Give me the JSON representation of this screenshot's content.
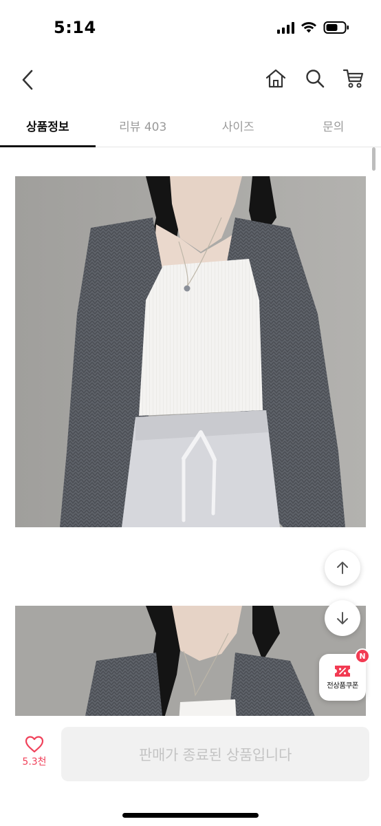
{
  "status_bar": {
    "time": "5:14"
  },
  "header": {
    "icons": [
      "back-icon",
      "home-icon",
      "search-icon",
      "cart-icon"
    ]
  },
  "tabs": [
    {
      "label": "상품정보",
      "active": true
    },
    {
      "label": "리뷰 403",
      "active": false
    },
    {
      "label": "사이즈",
      "active": false
    },
    {
      "label": "문의",
      "active": false
    }
  ],
  "floating": {
    "coupon_label": "전상품쿠폰",
    "coupon_badge": "N"
  },
  "bottom_bar": {
    "like_count": "5.3천",
    "buy_button_label": "판매가 종료된 상품입니다"
  },
  "colors": {
    "accent_pink": "#f0415a",
    "badge_red": "#f23a52",
    "disabled_button_bg": "#f1f1f1",
    "disabled_button_text": "#c4c4c4",
    "cardigan_gray": "#5d6168"
  }
}
